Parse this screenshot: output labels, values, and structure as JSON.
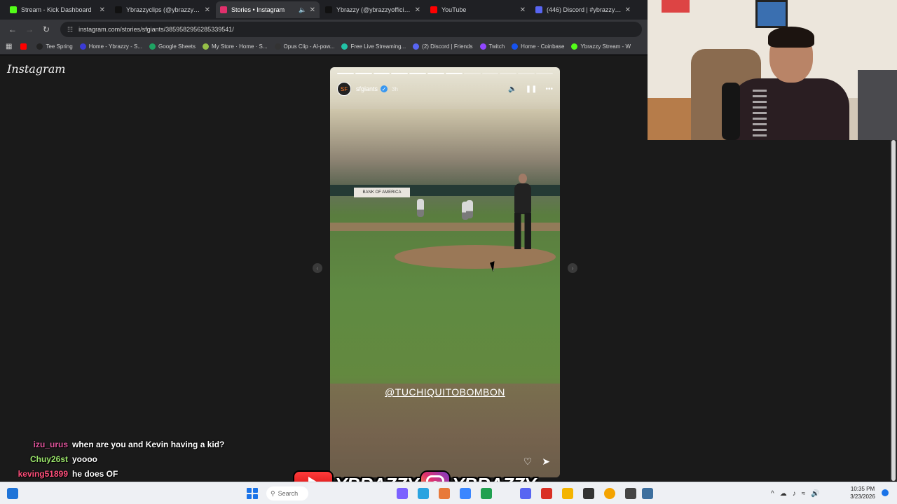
{
  "browser": {
    "tabs": [
      {
        "title": "Stream - Kick Dashboard",
        "color": "#53fc18",
        "active": false,
        "audio": false
      },
      {
        "title": "Ybrazzyclips (@ybrazzyclips)",
        "color": "#111111",
        "active": false,
        "audio": false
      },
      {
        "title": "Stories • Instagram",
        "color": "#e1306c",
        "active": true,
        "audio": true
      },
      {
        "title": "Ybrazzy (@ybrazzyofficial) |",
        "color": "#111111",
        "active": false,
        "audio": false
      },
      {
        "title": "YouTube",
        "color": "#ff0000",
        "active": false,
        "audio": false
      },
      {
        "title": "(446) Discord | #ybrazzy | LO",
        "color": "#5865f2",
        "active": false,
        "audio": false
      }
    ],
    "url": "instagram.com/stories/sfgiants/3859582956285339541/",
    "bookmarks": [
      {
        "label": "Tee Spring",
        "color": "#222222"
      },
      {
        "label": "Home - Ybrazzy - S...",
        "color": "#3b3bd6"
      },
      {
        "label": "Google Sheets",
        "color": "#1ea362"
      },
      {
        "label": "My Store · Home · S...",
        "color": "#95bf47"
      },
      {
        "label": "Opus Clip - AI-pow...",
        "color": "#333333"
      },
      {
        "label": "Free Live Streaming...",
        "color": "#22c3a6"
      },
      {
        "label": "(2) Discord | Friends",
        "color": "#5865f2"
      },
      {
        "label": "Twitch",
        "color": "#9146ff"
      },
      {
        "label": "Home · Coinbase",
        "color": "#1652f0"
      },
      {
        "label": "Ybrazzy Stream - W",
        "color": "#53fc18"
      }
    ]
  },
  "instagram": {
    "logo": "Instagram",
    "story": {
      "username": "sfgiants",
      "time": "3h",
      "segments_total": 12,
      "segments_done": 7,
      "mention": "@TUCHIQUITOBOMBON",
      "sponsor": "BANK OF AMERICA"
    }
  },
  "chat": [
    {
      "user": "izu_urus",
      "color": "#e0559c",
      "message": "when are you and Kevin having a kid?"
    },
    {
      "user": "Chuy26st",
      "color": "#9be56b",
      "message": "yoooo"
    },
    {
      "user": "keving51899",
      "color": "#ff4f7b",
      "message": "he does OF"
    }
  ],
  "banner": {
    "youtube_handle": "YBRAZZY",
    "instagram_handle": "YBRAZZY"
  },
  "taskbar": {
    "search_placeholder": "Search",
    "time": "10:35 PM",
    "date": "3/23/2026"
  }
}
